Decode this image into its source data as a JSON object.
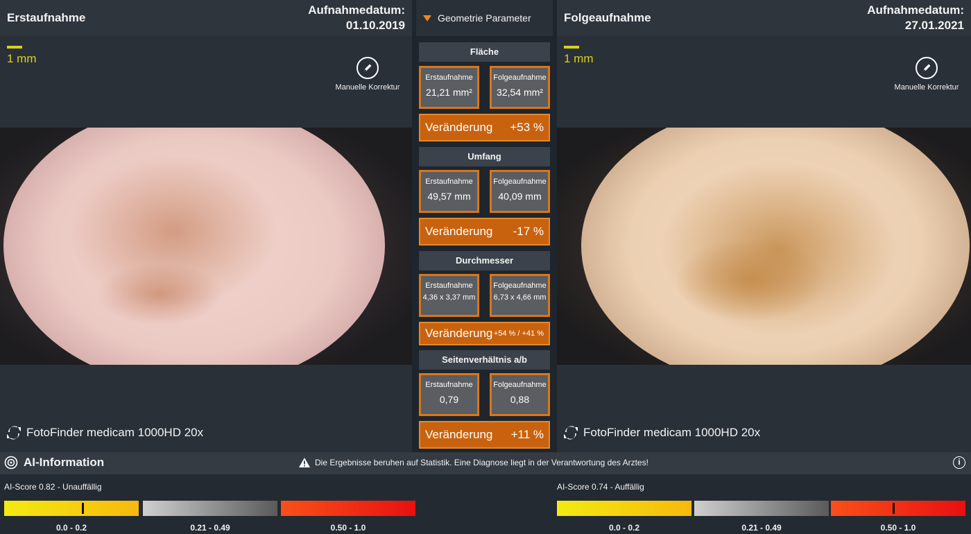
{
  "left_panel": {
    "title": "Erstaufnahme",
    "date_label": "Aufnahmedatum:",
    "date": "01.10.2019",
    "scale": "1 mm",
    "edit_label": "Manuelle Korrektur",
    "device": "FotoFinder medicam 1000HD 20x"
  },
  "right_panel": {
    "title": "Folgeaufnahme",
    "date_label": "Aufnahmedatum:",
    "date": "27.01.2021",
    "scale": "1 mm",
    "edit_label": "Manuelle Korrektur",
    "device": "FotoFinder medicam 1000HD 20x"
  },
  "geometry": {
    "header": "Geometrie Parameter",
    "first_label": "Erstaufnahme",
    "follow_label": "Folgeaufnahme",
    "change_label": "Veränderung",
    "sections": [
      {
        "title": "Fläche",
        "first": "21,21 mm²",
        "follow": "32,54 mm²",
        "change": "+53 %"
      },
      {
        "title": "Umfang",
        "first": "49,57 mm",
        "follow": "40,09 mm",
        "change": "-17 %"
      },
      {
        "title": "Durchmesser",
        "first": "4,36 x 3,37 mm",
        "follow": "6,73 x 4,66 mm",
        "change": "+54 % / +41 %"
      },
      {
        "title": "Seitenverhältnis a/b",
        "first": "0,79",
        "follow": "0,88",
        "change": "+11 %"
      }
    ]
  },
  "ai": {
    "title": "AI-Information",
    "warning": "Die Ergebnisse beruhen auf Statistik. Eine Diagnose liegt in der Verantwortung des Arztes!",
    "info": "i",
    "ranges": [
      "0.0 - 0.2",
      "0.21 - 0.49",
      "0.50 - 1.0"
    ],
    "left": {
      "label": "AI-Score 0.82 - Unauffällig",
      "score": 0.82
    },
    "right": {
      "label": "AI-Score 0.74 - Auffällig",
      "score": 0.74
    }
  },
  "colors": {
    "accent_orange": "#c9620e",
    "accent_border": "#d8771b",
    "scale_yellow": "#d6d21e"
  }
}
